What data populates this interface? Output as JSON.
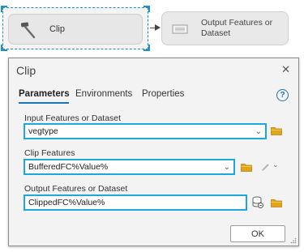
{
  "model_builder": {
    "tool_label": "Clip",
    "output_label": "Output Features or Dataset"
  },
  "dialog": {
    "title": "Clip",
    "close_glyph": "✕",
    "tabs": [
      {
        "label": "Parameters",
        "active": true
      },
      {
        "label": "Environments",
        "active": false
      },
      {
        "label": "Properties",
        "active": false
      }
    ],
    "help_glyph": "?",
    "params": {
      "input": {
        "label": "Input Features or Dataset",
        "value": "vegtype"
      },
      "clip": {
        "label": "Clip Features",
        "value": "BufferedFC%Value%"
      },
      "output": {
        "label": "Output Features or Dataset",
        "value": "ClippedFC%Value%"
      }
    },
    "ok_label": "OK",
    "chevron_glyph": "⌄"
  },
  "colors": {
    "highlight": "#1fa6dc",
    "accent": "#1a73b8",
    "folder": "#e0a51b"
  },
  "icons": [
    "hammer-icon",
    "dataset-icon",
    "close-icon",
    "help-icon",
    "folder-icon",
    "pencil-icon",
    "database-icon",
    "chevron-down-icon"
  ]
}
